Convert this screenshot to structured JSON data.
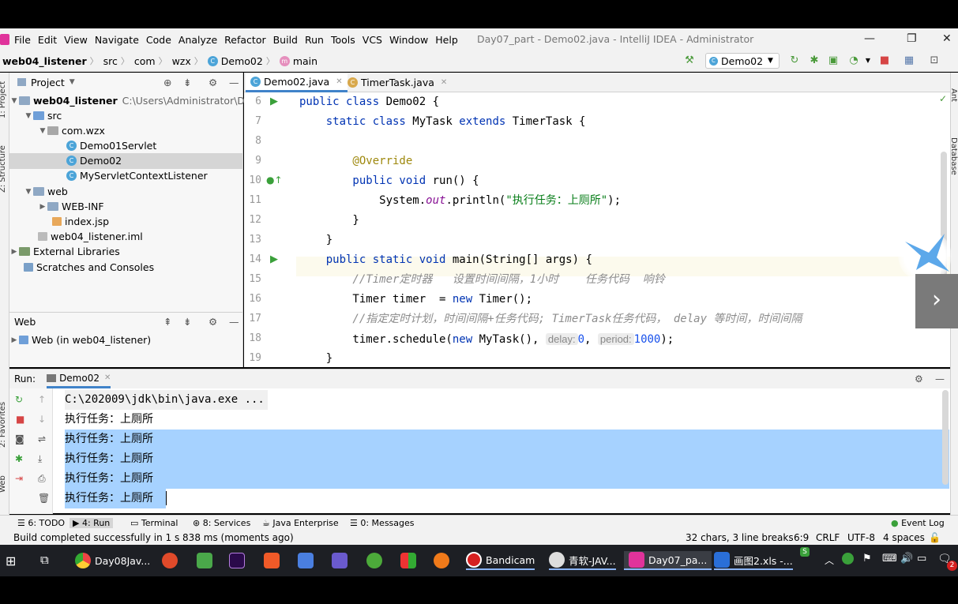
{
  "menu": {
    "items": [
      "File",
      "Edit",
      "View",
      "Navigate",
      "Code",
      "Analyze",
      "Refactor",
      "Build",
      "Run",
      "Tools",
      "VCS",
      "Window",
      "Help"
    ],
    "title": "Day07_part - Demo02.java - IntelliJ IDEA - Administrator"
  },
  "nav": {
    "crumbs": [
      "web04_listener",
      "src",
      "com",
      "wzx",
      "Demo02",
      "main"
    ],
    "run_config": "Demo02"
  },
  "left_strip": {
    "project": "1: Project",
    "structure": "Z: Structure",
    "favorites": "2: Favorites",
    "web": "Web"
  },
  "right_strip": {
    "ant": "Ant",
    "database": "Database"
  },
  "project": {
    "header": "Project",
    "tree": [
      {
        "label": "web04_listener",
        "extra": "C:\\Users\\Administrator\\Deskto"
      },
      {
        "label": "src"
      },
      {
        "label": "com.wzx"
      },
      {
        "label": "Demo01Servlet"
      },
      {
        "label": "Demo02"
      },
      {
        "label": "MyServletContextListener"
      },
      {
        "label": "web"
      },
      {
        "label": "WEB-INF"
      },
      {
        "label": "index.jsp"
      },
      {
        "label": "web04_listener.iml"
      },
      {
        "label": "External Libraries"
      },
      {
        "label": "Scratches and Consoles"
      }
    ],
    "web_header": "Web",
    "web_item": "Web (in web04_listener)"
  },
  "editor": {
    "tabs": [
      "Demo02.java",
      "TimerTask.java"
    ],
    "line_numbers": [
      "6",
      "7",
      "8",
      "9",
      "10",
      "11",
      "12",
      "13",
      "14",
      "15",
      "16",
      "17",
      "18",
      "19"
    ],
    "code": {
      "l6a": "public class",
      "l6b": " Demo02 {",
      "l7a": "    static class",
      "l7b": " MyTask ",
      "l7c": "extends",
      "l7d": " TimerTask {",
      "l9": "        @Override",
      "l10a": "        public void",
      "l10b": " run() {",
      "l11a": "            System.",
      "l11b": "out",
      "l11c": ".println(",
      "l11d": "\"执行任务：上厕所\"",
      "l11e": ");",
      "l12": "        }",
      "l13": "    }",
      "l14a": "    public static void",
      "l14b": " main(String[] args) {",
      "l15": "        //Timer定时器   设置时间间隔，1小时    任务代码  响铃",
      "l16a": "        Timer timer  = ",
      "l16b": "new",
      "l16c": " Timer();",
      "l17": "        //指定定时计划，时间间隔+任务代码; TimerTask任务代码， delay 等时间，时间间隔",
      "l18a": "        timer.schedule(",
      "l18b": "new",
      "l18c": " MyTask(), ",
      "l18d": "delay:",
      "l18e": "0",
      "l18f": ", ",
      "l18g": "period:",
      "l18h": "1000",
      "l18i": ");",
      "l19": "    }"
    }
  },
  "run": {
    "label": "Run:",
    "tab": "Demo02",
    "cmd": "C:\\202009\\jdk\\bin\\java.exe ...",
    "lines": [
      "执行任务：上厕所",
      "执行任务：上厕所",
      "执行任务：上厕所",
      "执行任务：上厕所",
      "执行任务：上厕所"
    ]
  },
  "bottom_tools": [
    "6: TODO",
    "4: Run",
    "Terminal",
    "8: Services",
    "Java Enterprise",
    "0: Messages",
    "Event Log"
  ],
  "status": {
    "message": "Build completed successfully in 1 s 838 ms (moments ago)",
    "chars": "32 chars, 3 line breaks",
    "pos": "6:9",
    "crlf": "CRLF",
    "enc": "UTF-8",
    "indent": "4 spaces"
  },
  "taskbar": {
    "items": [
      "Day08Jav...",
      "Bandicam",
      "青软-JAV...",
      "Day07_pa...",
      "画图2.xls -..."
    ],
    "badge": "2"
  },
  "colors": {
    "accent": "#0033b3",
    "selection": "#a6d2ff"
  }
}
